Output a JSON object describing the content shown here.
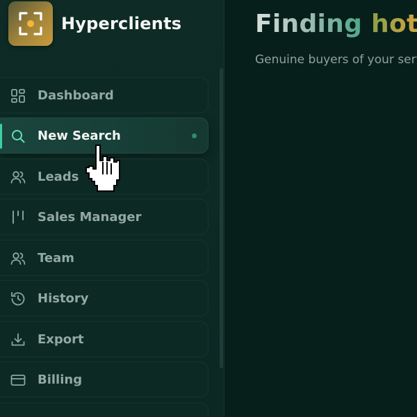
{
  "app": {
    "name": "Hyperclients",
    "accent": "#3ecfa3",
    "brand_gold": "#c79a3c"
  },
  "sidebar": {
    "items": [
      {
        "label": "Dashboard",
        "icon": "dashboard-grid-icon",
        "active": false
      },
      {
        "label": "New Search",
        "icon": "search-icon",
        "active": true
      },
      {
        "label": "Leads",
        "icon": "users-icon",
        "active": false
      },
      {
        "label": "Sales Manager",
        "icon": "kanban-columns-icon",
        "active": false
      },
      {
        "label": "Team",
        "icon": "team-icon",
        "active": false
      },
      {
        "label": "History",
        "icon": "history-icon",
        "active": false
      },
      {
        "label": "Export",
        "icon": "download-icon",
        "active": false
      },
      {
        "label": "Billing",
        "icon": "credit-card-icon",
        "active": false
      }
    ]
  },
  "main": {
    "title_part1": "Finding ",
    "title_part2": "hot l",
    "subtitle": "Genuine buyers of your serv"
  }
}
